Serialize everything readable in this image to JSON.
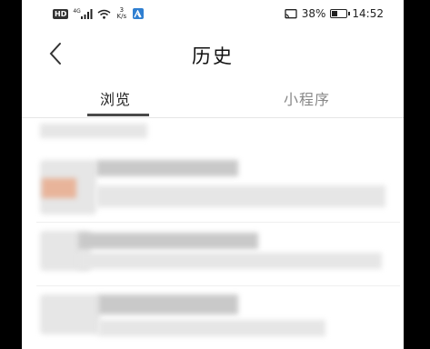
{
  "status_bar": {
    "hd_badge": "HD",
    "network": "4G",
    "speed_value": "3",
    "speed_unit": "K/s",
    "battery": "38%",
    "battery_level": 0.38,
    "time": "14:52",
    "app_icon_color": "#2f7fd1"
  },
  "header": {
    "title": "历史",
    "back_icon": "chevron-left-icon"
  },
  "tabs": [
    {
      "label": "浏览",
      "active": true
    },
    {
      "label": "小程序",
      "active": false
    }
  ],
  "colors": {
    "active_tab": "#222222",
    "inactive_tab": "#888888",
    "thumbnail_accent": "#e8b49a"
  }
}
